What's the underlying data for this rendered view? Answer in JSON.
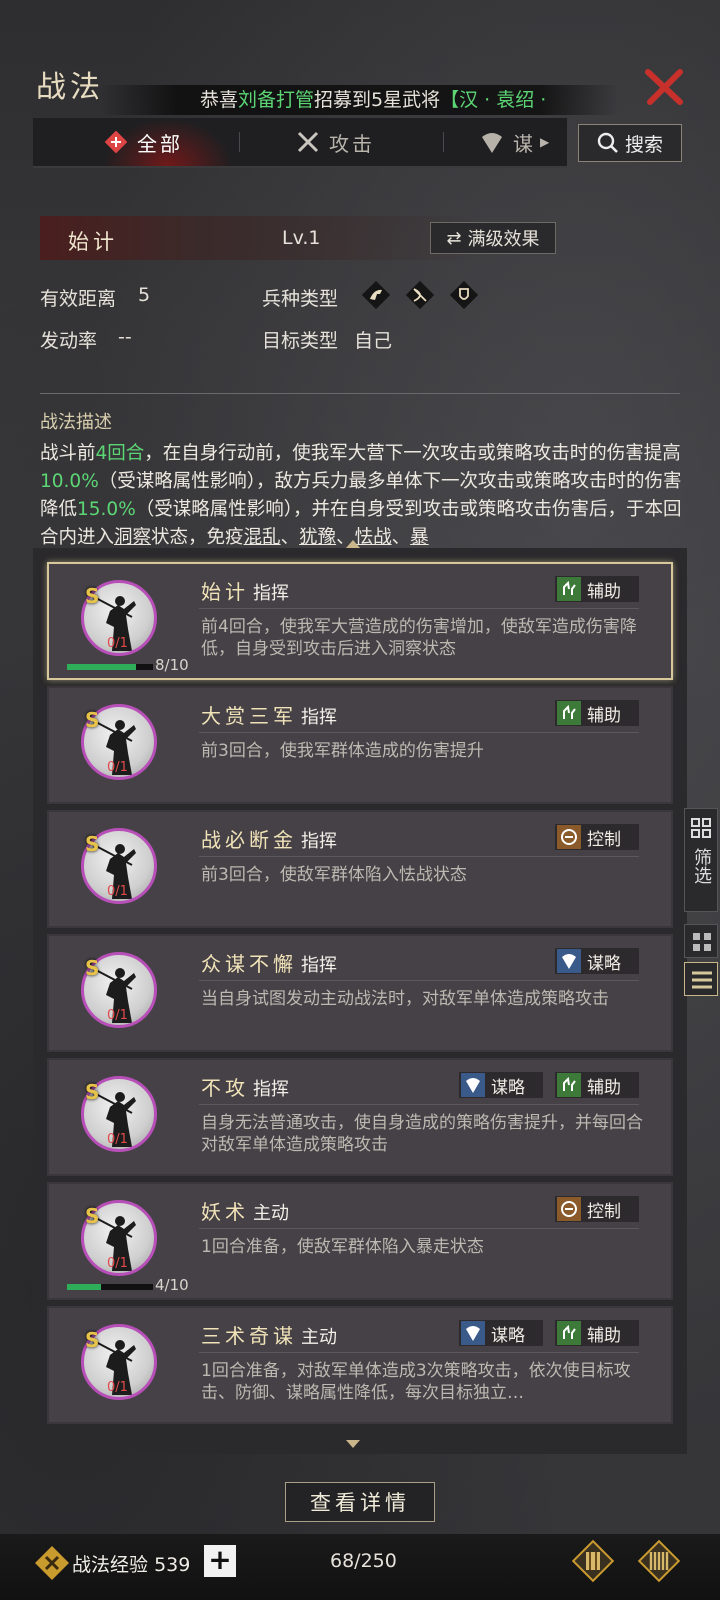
{
  "header": {
    "title": "战法",
    "ticker": {
      "prefix": "恭喜",
      "player": "刘备打管",
      "mid": "招募到5星武将",
      "hero": "【汉 · 袁绍 ·"
    }
  },
  "tabs": [
    {
      "label": "全部",
      "icon": "scroll-icon",
      "active": true
    },
    {
      "label": "攻击",
      "icon": "crossed-swords-icon",
      "active": false
    },
    {
      "label": "谋",
      "icon": "fan-icon",
      "active": false
    }
  ],
  "search_label": "搜索",
  "detail": {
    "name": "始计",
    "level": "Lv.1",
    "max_effect_label": "满级效果",
    "range_label": "有效距离",
    "range_value": "5",
    "troop_label": "兵种类型",
    "troop_icons": [
      "cavalry-icon",
      "archer-icon",
      "shield-icon"
    ],
    "rate_label": "发动率",
    "rate_value": "--",
    "target_label": "目标类型",
    "target_value": "自己",
    "desc_title": "战法描述",
    "desc": {
      "p1": "战斗前",
      "g1": "4回合",
      "p2": "，在自身行动前，使我军大营下一次攻击或策略攻击时的伤害提高",
      "g2": "10.0%",
      "p3": "（受谋略属性影响），敌方兵力最多单体下一次攻击或策略攻击时的伤害降低",
      "g3": "15.0%",
      "p4": "（受谋略属性影响），并在自身受到攻击或策略攻击伤害后，于本回合内进入",
      "u1": "洞察",
      "p5": "状态，免疫",
      "u2": "混乱",
      "p6": "、",
      "u3": "犹豫",
      "p7": "、",
      "u4": "怯战",
      "p8": "、",
      "u5": "暴"
    }
  },
  "cards": [
    {
      "name": "始计",
      "type": "指挥",
      "desc": "前4回合，使我军大营造成的伤害增加，使敌军造成伤害降低，自身受到攻击后进入洞察状态",
      "grade": "S",
      "count": "0/1",
      "exp": "8/10",
      "exp_fraction": 0.8,
      "tags": [
        {
          "label": "辅助",
          "icon": "assist-icon",
          "color": "#3d7a3a"
        }
      ],
      "selected": true
    },
    {
      "name": "大赏三军",
      "type": "指挥",
      "desc": "前3回合，使我军群体造成的伤害提升",
      "grade": "S",
      "count": "0/1",
      "tags": [
        {
          "label": "辅助",
          "icon": "assist-icon",
          "color": "#3d7a3a"
        }
      ]
    },
    {
      "name": "战必断金",
      "type": "指挥",
      "desc": "前3回合，使敌军群体陷入怯战状态",
      "grade": "S",
      "count": "0/1",
      "tags": [
        {
          "label": "控制",
          "icon": "control-icon",
          "color": "#8a5a2a"
        }
      ]
    },
    {
      "name": "众谋不懈",
      "type": "指挥",
      "desc": "当自身试图发动主动战法时，对敌军单体造成策略攻击",
      "grade": "S",
      "count": "0/1",
      "tags": [
        {
          "label": "谋略",
          "icon": "strategy-icon",
          "color": "#3a5a8a"
        }
      ]
    },
    {
      "name": "不攻",
      "type": "指挥",
      "desc": "自身无法普通攻击，使自身造成的策略伤害提升，并每回合对敌军单体造成策略攻击",
      "grade": "S",
      "count": "0/1",
      "tags": [
        {
          "label": "谋略",
          "icon": "strategy-icon",
          "color": "#3a5a8a"
        },
        {
          "label": "辅助",
          "icon": "assist-icon",
          "color": "#3d7a3a"
        }
      ]
    },
    {
      "name": "妖术",
      "type": "主动",
      "desc": "1回合准备，使敌军群体陷入暴走状态",
      "grade": "S",
      "count": "0/1",
      "exp": "4/10",
      "exp_fraction": 0.4,
      "tags": [
        {
          "label": "控制",
          "icon": "control-icon",
          "color": "#8a5a2a"
        }
      ]
    },
    {
      "name": "三术奇谋",
      "type": "主动",
      "desc": "1回合准备，对敌军单体造成3次策略攻击，依次使目标攻击、防御、谋略属性降低，每次目标独立…",
      "grade": "S",
      "count": "0/1",
      "tags": [
        {
          "label": "谋略",
          "icon": "strategy-icon",
          "color": "#3a5a8a"
        },
        {
          "label": "辅助",
          "icon": "assist-icon",
          "color": "#3d7a3a"
        }
      ]
    }
  ],
  "filter_label": "筛选",
  "view_detail_label": "查看详情",
  "footer": {
    "exp_label": "战法经验",
    "exp_value": "539",
    "plus": "+",
    "capacity": "68/250"
  }
}
